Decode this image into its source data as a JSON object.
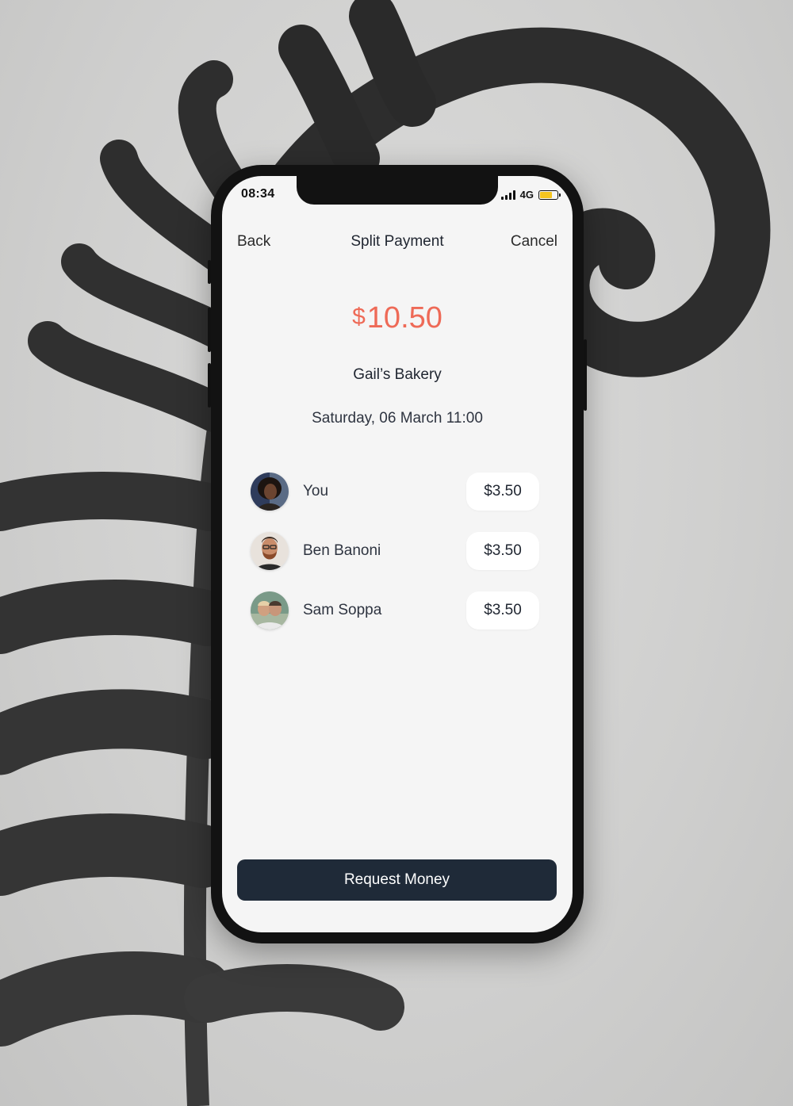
{
  "status_bar": {
    "time": "08:34",
    "network": "4G",
    "signal_icon": "signal-bars-icon",
    "battery_icon": "battery-icon",
    "battery_color": "#f5c51f"
  },
  "nav": {
    "back_label": "Back",
    "title": "Split Payment",
    "cancel_label": "Cancel"
  },
  "payment": {
    "currency_symbol": "$",
    "amount": "10.50",
    "merchant": "Gail’s Bakery",
    "datetime": "Saturday, 06 March 11:00",
    "amount_color": "#ee6a57"
  },
  "people": [
    {
      "name": "You",
      "share": "$3.50"
    },
    {
      "name": "Ben Banoni",
      "share": "$3.50"
    },
    {
      "name": "Sam Soppa",
      "share": "$3.50"
    }
  ],
  "actions": {
    "request_label": "Request Money",
    "button_color": "#1f2a38"
  }
}
